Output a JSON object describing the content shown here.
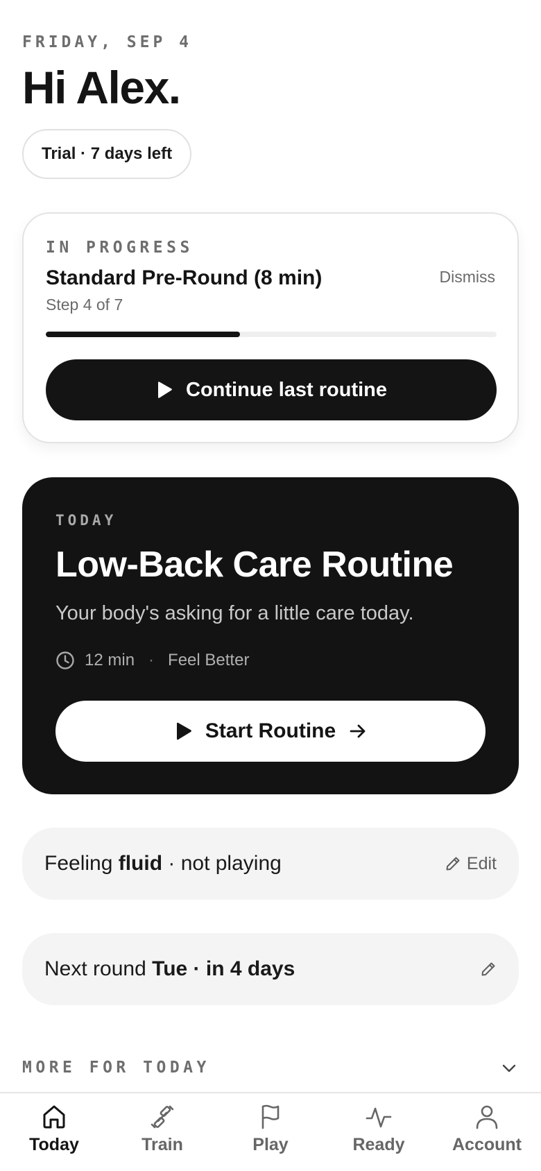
{
  "header": {
    "date": "FRIDAY, SEP 4",
    "greeting": "Hi Alex.",
    "trial_badge": "Trial · 7 days left"
  },
  "in_progress": {
    "label": "IN PROGRESS",
    "title": "Standard Pre-Round (8 min)",
    "step": "Step 4 of 7",
    "dismiss_label": "Dismiss",
    "progress_fraction": 0.43,
    "button_label": "Continue last routine",
    "button_icon": "play-icon"
  },
  "today": {
    "label": "TODAY",
    "title": "Low-Back Care Routine",
    "subtitle": "Your body's asking for a little care today.",
    "duration": "12 min",
    "separator": "·",
    "goal": "Feel Better",
    "button_label": "Start Routine",
    "button_icons": [
      "play-icon",
      "arrow-right-icon"
    ]
  },
  "feeling": {
    "prefix": "Feeling ",
    "state": "fluid",
    "suffix": " · not playing",
    "edit_label": "Edit",
    "edit_icon": "pencil-icon"
  },
  "next_round": {
    "prefix": "Next round ",
    "when": "Tue · in 4 days",
    "edit_icon": "pencil-icon"
  },
  "more": {
    "label": "MORE FOR TODAY",
    "icon": "chevron-down-icon"
  },
  "tabs": [
    {
      "label": "Today",
      "icon": "home-icon",
      "active": true
    },
    {
      "label": "Train",
      "icon": "dumbbell-icon",
      "active": false
    },
    {
      "label": "Play",
      "icon": "flag-icon",
      "active": false
    },
    {
      "label": "Ready",
      "icon": "pulse-icon",
      "active": false
    },
    {
      "label": "Account",
      "icon": "person-icon",
      "active": false
    }
  ],
  "colors": {
    "primary": "#141414",
    "muted_text": "#6e6e6e",
    "card_border": "#e3e3e3",
    "info_row_bg": "#f4f4f4",
    "track": "#efefef"
  }
}
